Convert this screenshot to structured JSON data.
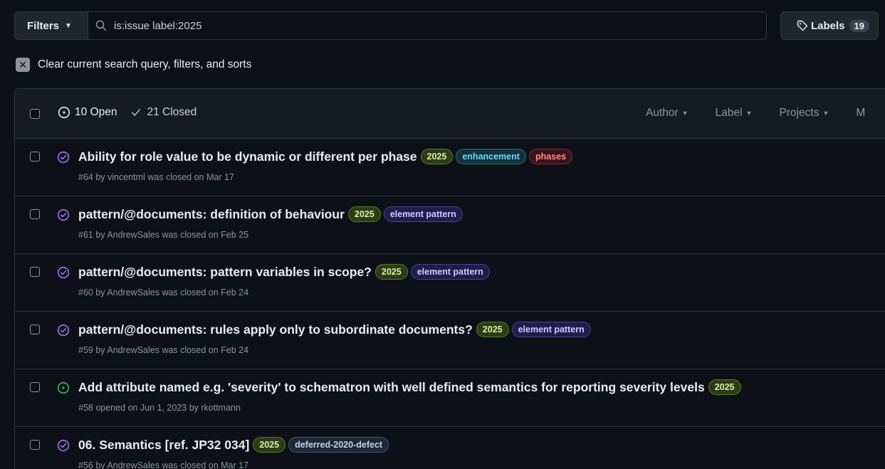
{
  "search": {
    "filters_label": "Filters",
    "query": "is:issue label:2025",
    "labels_label": "Labels",
    "labels_count": "19"
  },
  "clear": {
    "text": "Clear current search query, filters, and sorts"
  },
  "header": {
    "open_label": "10 Open",
    "closed_label": "21 Closed",
    "filters": [
      "Author",
      "Label",
      "Projects",
      "M"
    ]
  },
  "issues": [
    {
      "state": "closed",
      "title": "Ability for role value to be dynamic or different per phase",
      "labels": [
        {
          "name": "2025",
          "kind": "y2025"
        },
        {
          "name": "enhancement",
          "kind": "enh"
        },
        {
          "name": "phases",
          "kind": "phases"
        }
      ],
      "meta": "#64 by vincentml was closed on Mar 17"
    },
    {
      "state": "closed",
      "title": "pattern/@documents: definition of behaviour",
      "labels": [
        {
          "name": "2025",
          "kind": "y2025"
        },
        {
          "name": "element pattern",
          "kind": "elem"
        }
      ],
      "meta": "#61 by AndrewSales was closed on Feb 25"
    },
    {
      "state": "closed",
      "title": "pattern/@documents: pattern variables in scope?",
      "labels": [
        {
          "name": "2025",
          "kind": "y2025"
        },
        {
          "name": "element pattern",
          "kind": "elem"
        }
      ],
      "meta": "#60 by AndrewSales was closed on Feb 24"
    },
    {
      "state": "closed",
      "title": "pattern/@documents: rules apply only to subordinate documents?",
      "labels": [
        {
          "name": "2025",
          "kind": "y2025"
        },
        {
          "name": "element pattern",
          "kind": "elem"
        }
      ],
      "meta": "#59 by AndrewSales was closed on Feb 24"
    },
    {
      "state": "open",
      "title": "Add attribute named e.g. 'severity' to schematron with well defined semantics for reporting severity levels",
      "labels": [
        {
          "name": "2025",
          "kind": "y2025"
        }
      ],
      "meta": "#58 opened on Jun 1, 2023 by rkottmann"
    },
    {
      "state": "closed",
      "title": "06. Semantics [ref. JP32 034]",
      "labels": [
        {
          "name": "2025",
          "kind": "y2025"
        },
        {
          "name": "deferred-2020-defect",
          "kind": "defer"
        }
      ],
      "meta": "#56 by AndrewSales was closed on Mar 17"
    }
  ],
  "colors": {
    "background": "#0d1117",
    "open_icon": "#3fb950",
    "closed_icon": "#a371f7",
    "border": "#30363d"
  }
}
